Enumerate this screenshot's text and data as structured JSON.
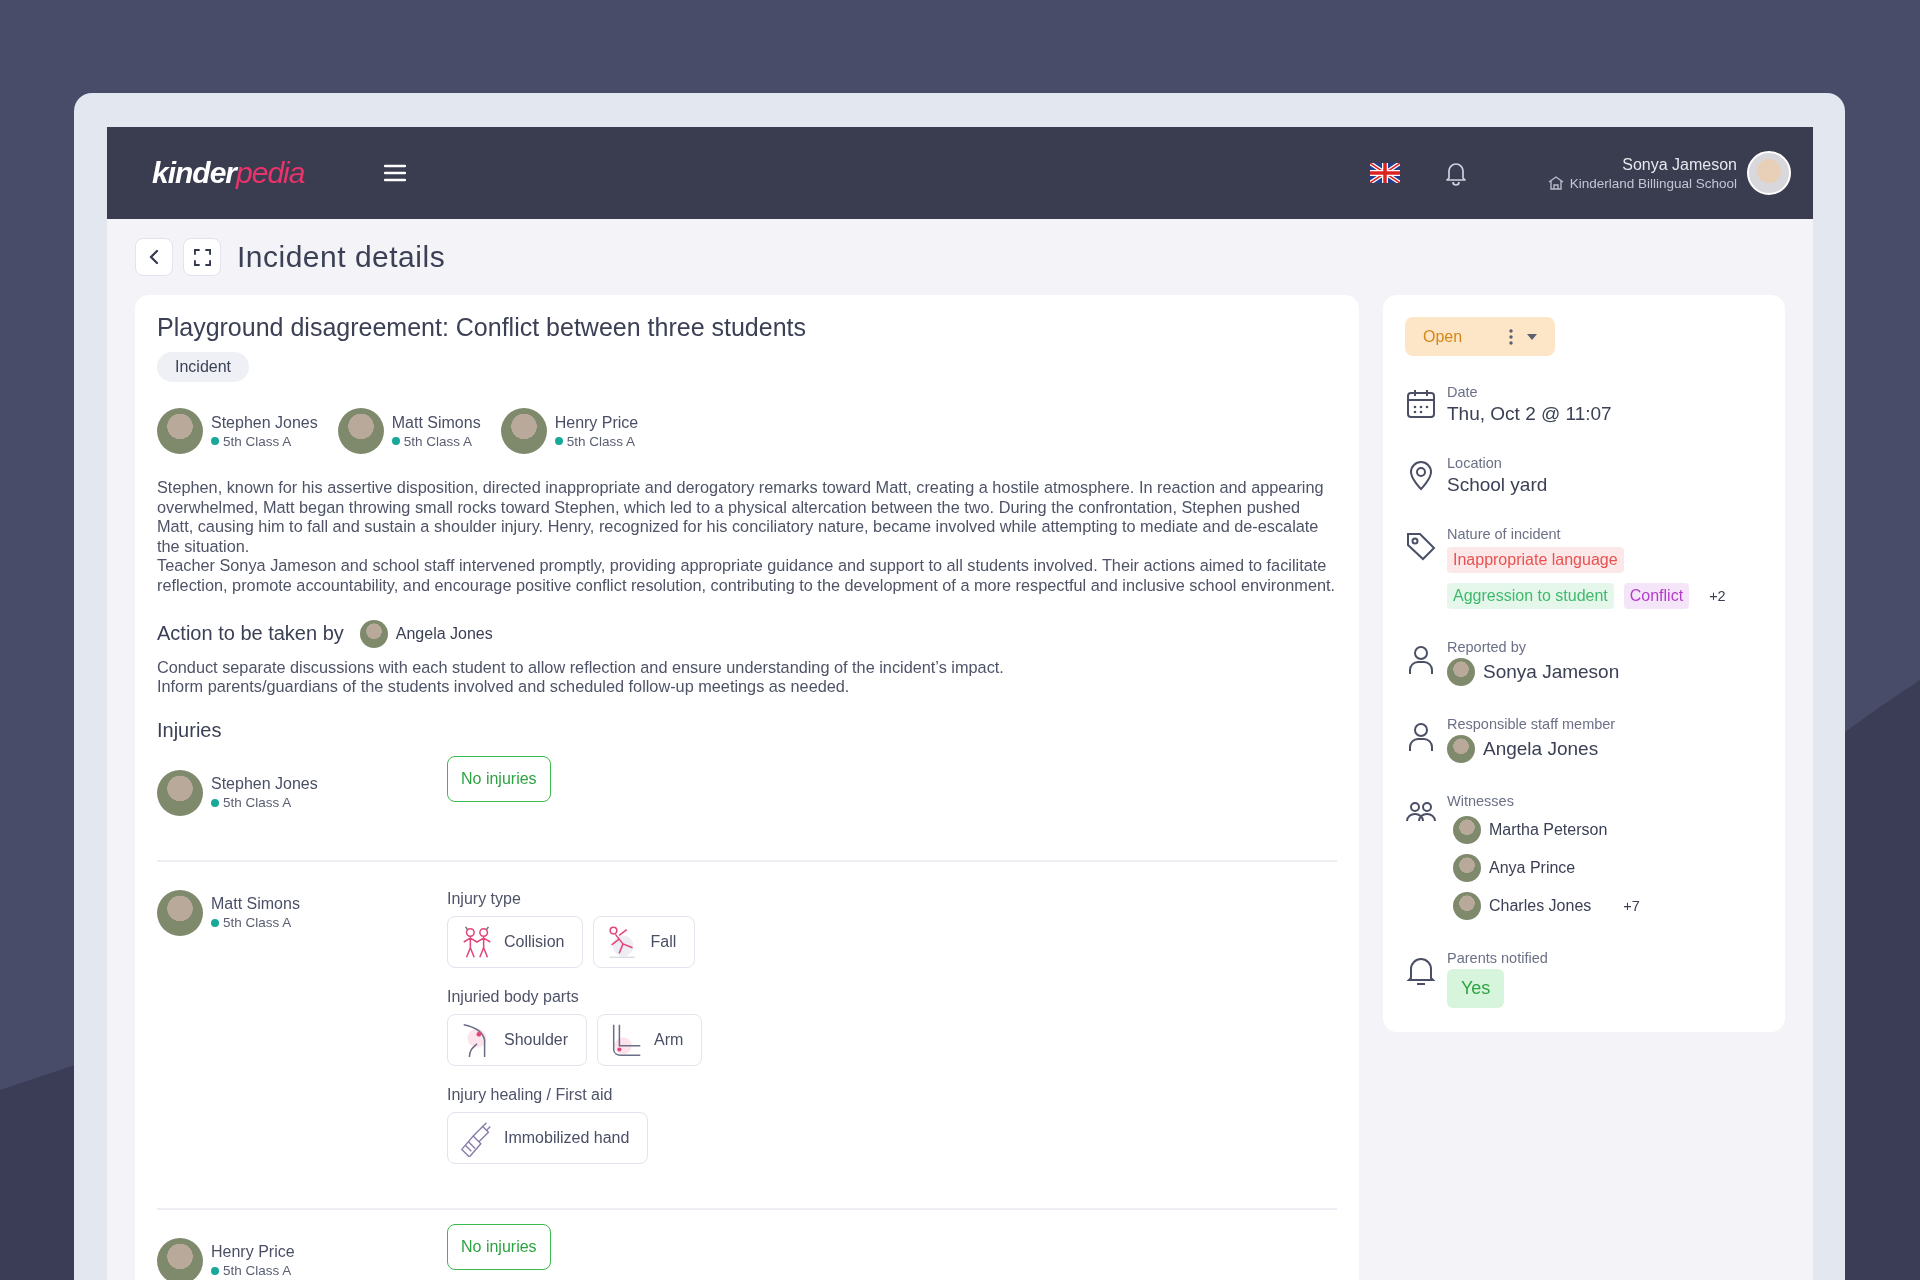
{
  "header": {
    "logo": {
      "part_1": "kinder",
      "part_2": "pedia"
    },
    "user": {
      "name": "Sonya Jameson",
      "school": "Kinderland Billingual School"
    }
  },
  "page": {
    "title": "Incident details"
  },
  "incident": {
    "title": "Playground disagreement: Conflict between three students",
    "type_badge": "Incident",
    "students": [
      {
        "name": "Stephen Jones",
        "class": "5th Class A"
      },
      {
        "name": "Matt Simons",
        "class": "5th Class A"
      },
      {
        "name": "Henry Price",
        "class": "5th Class A"
      }
    ],
    "description": [
      "Stephen, known for his assertive disposition, directed inappropriate and derogatory remarks toward Matt, creating a hostile atmosphere. In reaction and appearing overwhelmed, Matt began throwing small rocks toward Stephen, which led to a physical altercation between the two. During the confrontation, Stephen pushed Matt, causing him to fall and sustain a shoulder injury. Henry, recognized for his conciliatory nature, became involved while attempting to mediate and de-escalate the situation.",
      "Teacher Sonya Jameson and school staff intervened promptly, providing appropriate guidance and support to all students involved. Their actions aimed to facilitate reflection, promote accountability, and encourage positive conflict resolution, contributing to the development of a more respectful and inclusive school environment."
    ],
    "action": {
      "heading": "Action to be taken by",
      "assignee": "Angela Jones",
      "lines": [
        "Conduct separate discussions with each student to allow reflection and ensure understanding of the incident’s impact.",
        "Inform parents/guardians of the students involved and scheduled follow-up meetings as needed."
      ]
    },
    "injuries": {
      "heading": "Injuries",
      "rows": [
        {
          "kind": "none",
          "name": "Stephen Jones",
          "class": "5th Class A",
          "status": "No injuries"
        },
        {
          "kind": "detail",
          "name": "Matt Simons",
          "class": "5th Class A",
          "groups": [
            {
              "label": "Injury type",
              "items": [
                {
                  "kind": "collision",
                  "label": "Collision"
                },
                {
                  "kind": "fall",
                  "label": "Fall"
                }
              ]
            },
            {
              "label": "Injuried body parts",
              "items": [
                {
                  "kind": "shoulder",
                  "label": "Shoulder"
                },
                {
                  "kind": "arm",
                  "label": "Arm"
                }
              ]
            },
            {
              "label": "Injury healing / First aid",
              "items": [
                {
                  "kind": "bandage",
                  "label": "Immobilized hand"
                }
              ]
            }
          ]
        },
        {
          "kind": "none",
          "name": "Henry Price",
          "class": "5th Class A",
          "status": "No injuries"
        }
      ]
    }
  },
  "details": {
    "status": "Open",
    "fields": [
      {
        "kind": "date",
        "label": "Date",
        "value": "Thu, Oct 2 @ 11:07"
      },
      {
        "kind": "location",
        "label": "Location",
        "value": "School yard"
      },
      {
        "kind": "tags",
        "label": "Nature of incident",
        "tags": [
          {
            "label": "Inappropriate language",
            "color": "#e8514f"
          },
          {
            "label": "Aggression to student",
            "color": "#3dba6c"
          },
          {
            "label": "Conflict",
            "color": "#b43ccc"
          }
        ],
        "more": "+2"
      },
      {
        "kind": "person",
        "label": "Reported by",
        "person": "Sonya Jameson"
      },
      {
        "kind": "person",
        "label": "Responsible staff member",
        "person": "Angela Jones"
      },
      {
        "kind": "people",
        "label": "Witnesses",
        "people": [
          "Martha Peterson",
          "Anya Prince",
          "Charles Jones"
        ],
        "more": "+7"
      },
      {
        "kind": "yesno",
        "label": "Parents notified",
        "value": "Yes"
      }
    ]
  }
}
